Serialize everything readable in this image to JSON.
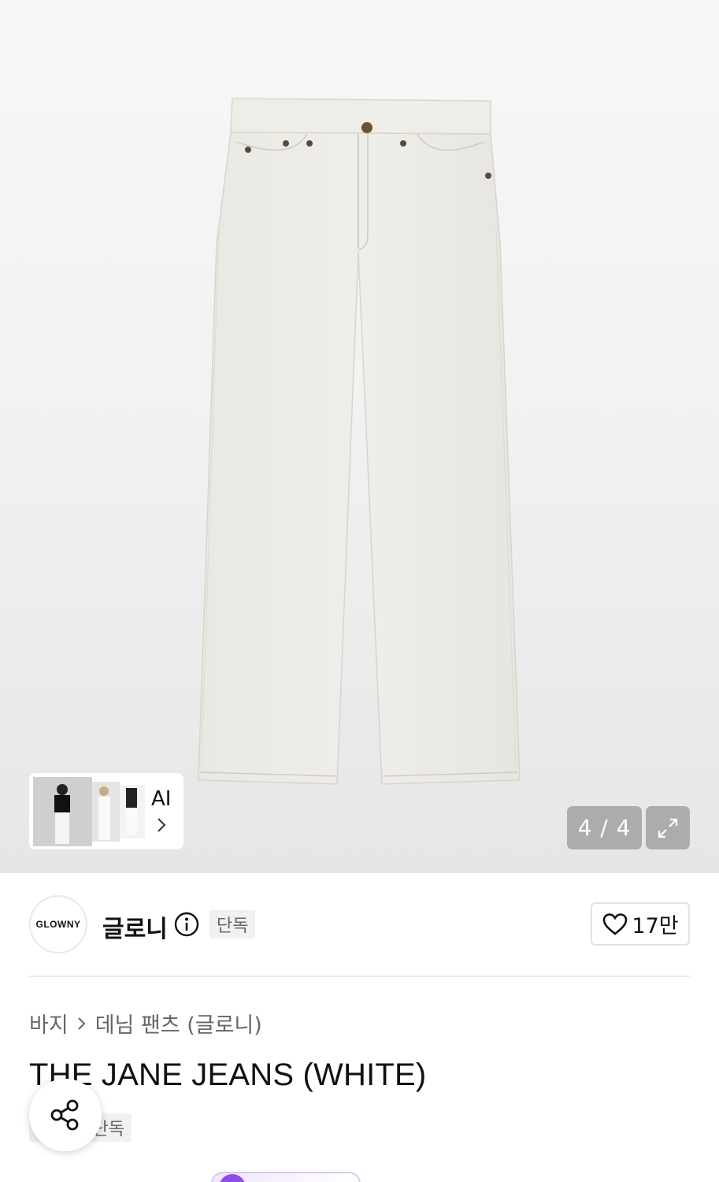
{
  "gallery": {
    "counter": "4 / 4",
    "ai_label": "AI",
    "colors": {
      "pants": "#ecebe6",
      "stitch": "#c9c5b8",
      "button": "#6b5330"
    }
  },
  "brand": {
    "logo_text": "GLOWNY",
    "name": "글로니",
    "badge": "단독",
    "like_count": "17만"
  },
  "breadcrumb": {
    "items": [
      "바지",
      "데님 팬츠 (글로니)"
    ]
  },
  "product": {
    "title": "THE JANE JEANS (WHITE)",
    "tag": "단독"
  },
  "icons": [
    "chevron-right-icon",
    "expand-icon",
    "info-icon",
    "heart-icon",
    "share-icon"
  ]
}
